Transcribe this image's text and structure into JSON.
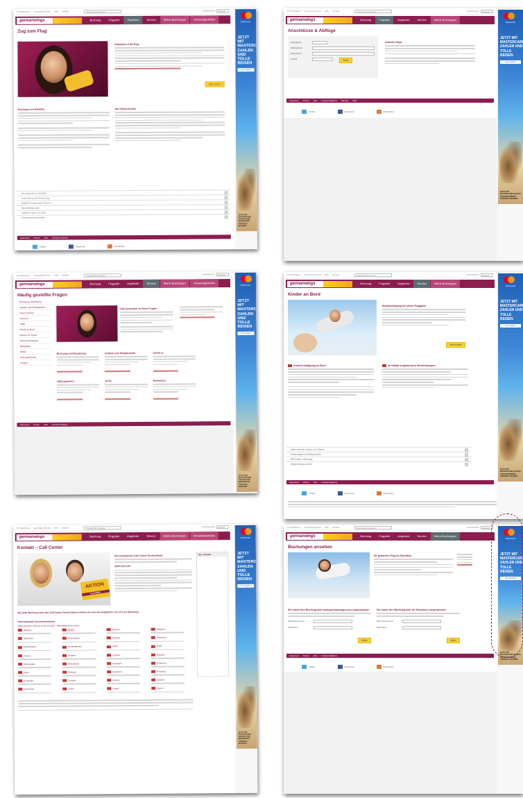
{
  "brand": {
    "logo": "germanwings",
    "accent": "#8c1d4f",
    "yellow": "#fcd22d"
  },
  "top_links": [
    "Für Mitarbeiter",
    "Geschäfts-Service",
    "Hilfe",
    "Kontakt"
  ],
  "search_placeholder": "Suchbegriff eingeben",
  "lang_label": "Land/Sprache",
  "lang_value": "Deutsch",
  "nav_items": [
    "Buchung",
    "Flugziele",
    "Angebote",
    "Service",
    "Meine Buchungen",
    "Versandapotheke"
  ],
  "ad": {
    "brand_small": "Mastercard",
    "headline": "JETZT MIT MASTERCARD ZAHLEN UND TOLLE REISEN",
    "button": "Zum Angebot",
    "fineprint": "JETZT MIT MASTERCARD ZAHLEN UND BESONDERE VORTEILE SICHERN"
  },
  "social": [
    "Twitter",
    "Facebook",
    "Newsletter"
  ],
  "footer_links": [
    "Impressum",
    "Presse",
    "Jobs",
    "Investor Relations",
    "Sitemap",
    "AGB"
  ],
  "pages": {
    "zug": {
      "title": "Zug zum Flug",
      "box_title": "Bahnfahrt & Ab-Flug",
      "col1_title": "Buchung von Rail&Fly",
      "col2_title": "Ihre Reisevorteile",
      "cta": "Jetzt buchen",
      "accordion": [
        "Informationen zu Rail&Fly",
        "Umbuchung und Stornierung",
        "Rail&Fly Tickets beim Check-in",
        "Reisebedingungen",
        "Häufige Fragen zur Bahn",
        "Teilnehmende Bahnhöfe"
      ]
    },
    "anschluss": {
      "title": "Anschlüsse & Abflüge",
      "labels": [
        "Abflughafen",
        "Zielflughafen",
        "Reisedatum",
        "Anzahl"
      ],
      "side_title": "Aktuelle Flüge"
    },
    "faq": {
      "title": "Häufig gestellte Fragen",
      "sidebar": [
        "Buchung & Bezahlung",
        "Gepäck und Sitzplatzwahl",
        "Flug & Service",
        "Check-in",
        "Tarife",
        "Kinder an Bord",
        "Reisen mit Tieren",
        "Reiseversicherung",
        "Mietwagen",
        "Hotels",
        "Reisegutscheine",
        "Kontakt"
      ],
      "hero_title": "Alle Antworten zu Ihren Fragen",
      "groups": [
        "Buchung und Bezahlung",
        "Gepäck und Sitzplatzwahl",
        "Check-in",
        "Zahlungsarten",
        "Tarife",
        "Reiseinfos"
      ]
    },
    "kinder": {
      "title": "Kinder an Bord",
      "box_title": "Beaufsichtigung für kleine Fluggäste",
      "col1_title": "Kinderermäßigung an Bord",
      "col2_title": "Im Notfall eingebundene Bestimmungen",
      "cta": "Jetzt buchen",
      "accordion": [
        "Allein reisende Kinder ab 5 Jahren",
        "Kinderwagen und Babyschalen",
        "Mit Kindern unterwegs",
        "Babynahrung an Bord"
      ]
    },
    "kontakt": {
      "title": "Kontakt – Call Center",
      "badge": "AKTION",
      "badge_sub": "0,14 €/Min.",
      "hotline_title": "Servicenummer Call Center Deutschland",
      "phone": "0900 1919 100",
      "cta_text": "Bei jeder Buchung über das Call Center Deutschland erheben wir eine Servicegebühr von 15 € pro Buchung.",
      "intl_title": "Internationale Servicenummern",
      "intl_sub": "Öffnungszeiten: 6:00 bis 24:00 Uhr MEZ – Mindestpreise pro Anruf",
      "side_title": "Ihre Vorteile",
      "countries": [
        "Albanien",
        "Belgien",
        "Bosnien",
        "Bulgarien",
        "Dänemark",
        "Deutschland",
        "Finnland",
        "Frankreich",
        "Griechenland",
        "Großbritannien",
        "Irland",
        "Italien",
        "Kosovo",
        "Kroatien",
        "Lettland",
        "Marokko",
        "Montenegro",
        "Niederlande",
        "Norwegen",
        "Österreich",
        "Polen",
        "Portugal",
        "Rumänien",
        "Russland",
        "Schweden",
        "Schweiz",
        "Serbien",
        "Spanien",
        "Tschechien",
        "Türkei",
        "Ungarn",
        "Zypern"
      ]
    },
    "buchung": {
      "title": "Buchungen ansehen",
      "box_title": "Ihr gebuchter Flug im Überblick",
      "col1_title": "Sie haben Ihre Buchung über www.germanwings.com vorgenommen",
      "col2_title": "Sie haben Ihre Buchung über Ihr Reisebüro vorgenommen",
      "fields": [
        "Buchungsnummer",
        "Nachname"
      ],
      "cta": "Weiter"
    }
  }
}
